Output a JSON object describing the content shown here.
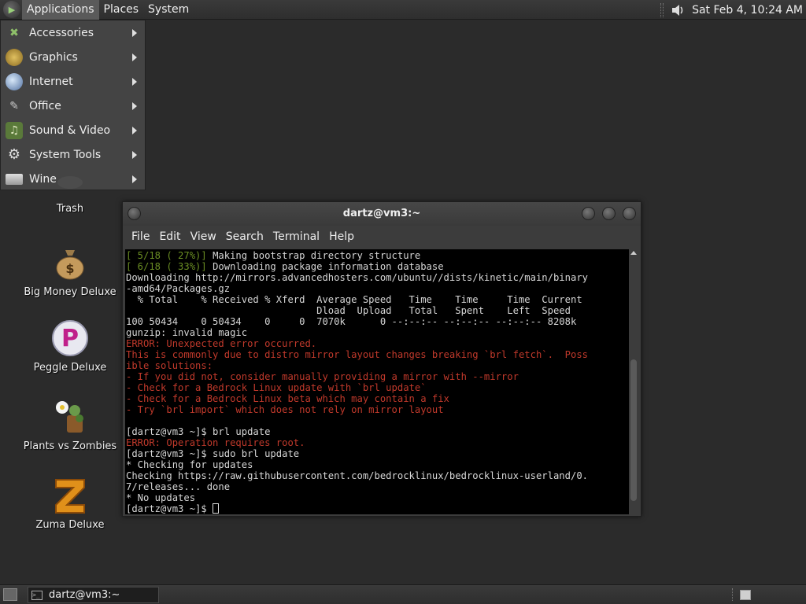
{
  "top_panel": {
    "menus": [
      "Applications",
      "Places",
      "System"
    ],
    "clock": "Sat Feb  4, 10:24 AM"
  },
  "app_menu": {
    "items": [
      {
        "label": "Accessories",
        "icon": "accessories-icon"
      },
      {
        "label": "Graphics",
        "icon": "graphics-icon"
      },
      {
        "label": "Internet",
        "icon": "internet-icon"
      },
      {
        "label": "Office",
        "icon": "office-icon"
      },
      {
        "label": "Sound & Video",
        "icon": "sound-video-icon"
      },
      {
        "label": "System Tools",
        "icon": "system-tools-icon"
      },
      {
        "label": "Wine",
        "icon": "wine-icon"
      }
    ]
  },
  "desktop_icons": [
    {
      "label": "Trash",
      "icon": "trash-icon"
    },
    {
      "label": "Big Money Deluxe",
      "icon": "money-bag-icon"
    },
    {
      "label": "Peggle Deluxe",
      "icon": "peggle-icon"
    },
    {
      "label": "Plants vs Zombies",
      "icon": "plants-vs-zombies-icon"
    },
    {
      "label": "Zuma Deluxe",
      "icon": "zuma-icon"
    }
  ],
  "terminal": {
    "title": "dartz@vm3:~",
    "menu": [
      "File",
      "Edit",
      "View",
      "Search",
      "Terminal",
      "Help"
    ],
    "lines": [
      {
        "color": "mixed",
        "prefix": "[ 5/18 ( 27%)] ",
        "text": "Making bootstrap directory structure"
      },
      {
        "color": "mixed",
        "prefix": "[ 6/18 ( 33%)] ",
        "text": "Downloading package information database"
      },
      {
        "color": "w",
        "text": "Downloading http://mirrors.advancedhosters.com/ubuntu//dists/kinetic/main/binary"
      },
      {
        "color": "w",
        "text": "-amd64/Packages.gz"
      },
      {
        "color": "w",
        "text": "  % Total    % Received % Xferd  Average Speed   Time    Time     Time  Current"
      },
      {
        "color": "w",
        "text": "                                 Dload  Upload   Total   Spent    Left  Speed"
      },
      {
        "color": "w",
        "text": "100 50434    0 50434    0     0  7070k      0 --:--:-- --:--:-- --:--:-- 8208k"
      },
      {
        "color": "w",
        "text": "gunzip: invalid magic"
      },
      {
        "color": "r",
        "text": "ERROR: Unexpected error occurred."
      },
      {
        "color": "r",
        "text": "This is commonly due to distro mirror layout changes breaking `brl fetch`.  Poss"
      },
      {
        "color": "r",
        "text": "ible solutions:"
      },
      {
        "color": "r",
        "text": "- If you did not, consider manually providing a mirror with --mirror"
      },
      {
        "color": "r",
        "text": "- Check for a Bedrock Linux update with `brl update`"
      },
      {
        "color": "r",
        "text": "- Check for a Bedrock Linux beta which may contain a fix"
      },
      {
        "color": "r",
        "text": "- Try `brl import` which does not rely on mirror layout"
      },
      {
        "color": "w",
        "text": ""
      },
      {
        "color": "w",
        "text": "[dartz@vm3 ~]$ brl update"
      },
      {
        "color": "r",
        "text": "ERROR: Operation requires root."
      },
      {
        "color": "w",
        "text": "[dartz@vm3 ~]$ sudo brl update"
      },
      {
        "color": "w",
        "text": "* Checking for updates"
      },
      {
        "color": "w",
        "text": "Checking https://raw.githubusercontent.com/bedrocklinux/bedrocklinux-userland/0."
      },
      {
        "color": "w",
        "text": "7/releases... done"
      },
      {
        "color": "w",
        "text": "* No updates"
      }
    ],
    "prompt": "[dartz@vm3 ~]$ "
  },
  "bottom_panel": {
    "task": "dartz@vm3:~"
  }
}
